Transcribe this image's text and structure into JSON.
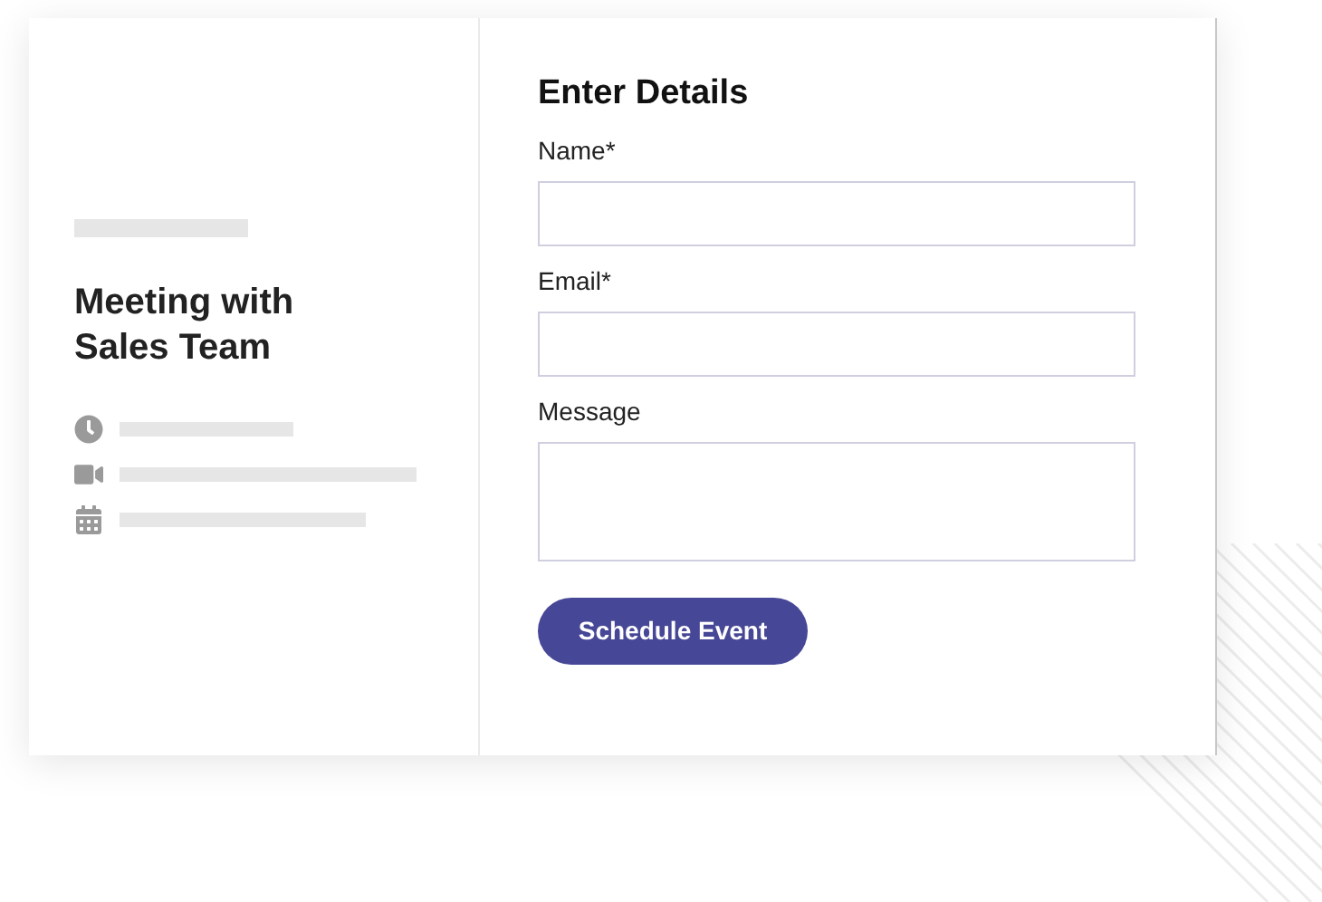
{
  "event": {
    "title": "Meeting with Sales Team",
    "details": [
      {
        "kind": "clock"
      },
      {
        "kind": "video"
      },
      {
        "kind": "calendar"
      }
    ]
  },
  "form": {
    "title": "Enter Details",
    "fields": [
      {
        "label": "Name*",
        "kind": "line"
      },
      {
        "label": "Email*",
        "kind": "line"
      },
      {
        "label": "Message",
        "kind": "area"
      }
    ],
    "submit": "Schedule Event"
  }
}
